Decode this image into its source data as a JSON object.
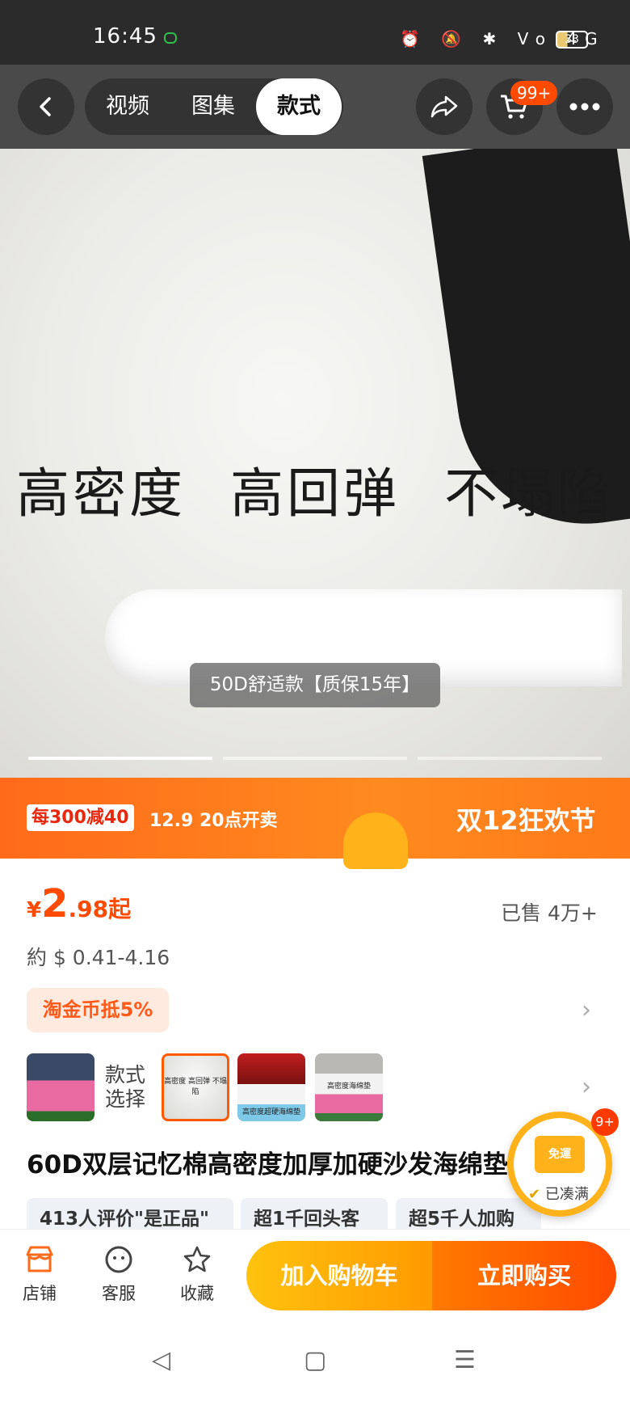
{
  "status_bar": {
    "time": "16:45",
    "battery": "33",
    "icons": "⏰ 🔕 ✱ Vo 4G"
  },
  "header": {
    "tabs": [
      {
        "label": "视频"
      },
      {
        "label": "图集"
      },
      {
        "label": "款式"
      }
    ],
    "cart_badge": "99+"
  },
  "hero": {
    "slogan": "高密度 高回弹 不塌陷",
    "variant_caption": "50D舒适款【质保15年】"
  },
  "promo": {
    "discount_tag": "每300减40",
    "start_time": "12.9 20点开卖",
    "festival": "双12狂欢节"
  },
  "product": {
    "price_symbol": "¥",
    "price_int": "2",
    "price_dec": ".98",
    "price_suffix": "起",
    "sold": "已售 4万+",
    "usd_price": "約 $ 0.41-4.16",
    "coin_tag": "淘金币抵5%",
    "style_label_1": "款式",
    "style_label_2": "选择",
    "thumb_texts": [
      "高密度 高回弹 不塌陷",
      "高密度超硬海绵垫",
      "高密度海绵垫"
    ],
    "title": "60D双层记忆棉高密度加厚加硬沙发海绵垫",
    "chips": [
      {
        "label": "413人评价\"是正品\""
      },
      {
        "label": "超1千回头客"
      },
      {
        "label": "超5千人加购"
      }
    ]
  },
  "float_badge": {
    "count": "9+",
    "truck_text": "免運",
    "label": "已凑满"
  },
  "bottom_bar": {
    "shop": "店铺",
    "service": "客服",
    "favorite": "收藏",
    "add_cart": "加入购物车",
    "buy_now": "立即购买"
  },
  "colors": {
    "accent": "#ff4a00",
    "promo": "#ff7a1a",
    "cart": "#ffb21a"
  }
}
